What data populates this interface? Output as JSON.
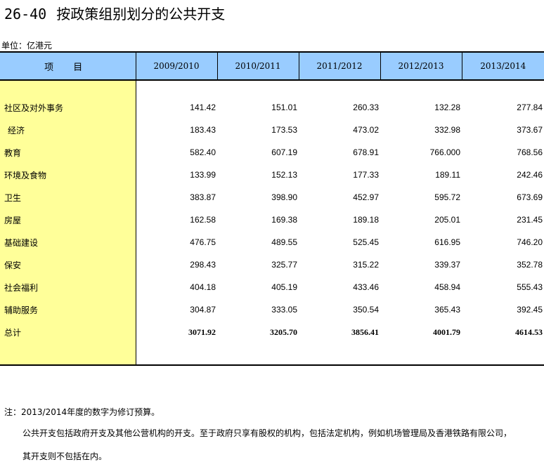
{
  "header": {
    "number": "26-40",
    "title": "按政策组别划分的公共开支",
    "unit": "单位：亿港元"
  },
  "table": {
    "columns": [
      "项 目",
      "2009/2010",
      "2010/2011",
      "2011/2012",
      "2012/2013",
      "2013/2014"
    ],
    "rows": [
      {
        "label": "社区及对外事务",
        "values": [
          "141.42",
          "151.01",
          "260.33",
          "132.28",
          "277.84"
        ]
      },
      {
        "label": "经济",
        "values": [
          "183.43",
          "173.53",
          "473.02",
          "332.98",
          "373.67"
        ]
      },
      {
        "label": "教育",
        "values": [
          "582.40",
          "607.19",
          "678.91",
          "766.000",
          "768.56"
        ]
      },
      {
        "label": "环境及食物",
        "values": [
          "133.99",
          "152.13",
          "177.33",
          "189.11",
          "242.46"
        ]
      },
      {
        "label": "卫生",
        "values": [
          "383.87",
          "398.90",
          "452.97",
          "595.72",
          "673.69"
        ]
      },
      {
        "label": "房屋",
        "values": [
          "162.58",
          "169.38",
          "189.18",
          "205.01",
          "231.45"
        ]
      },
      {
        "label": "基础建设",
        "values": [
          "476.75",
          "489.55",
          "525.45",
          "616.95",
          "746.20"
        ]
      },
      {
        "label": "保安",
        "values": [
          "298.43",
          "325.77",
          "315.22",
          "339.37",
          "352.78"
        ]
      },
      {
        "label": "社会福利",
        "values": [
          "404.18",
          "405.19",
          "433.46",
          "458.94",
          "555.43"
        ]
      },
      {
        "label": "辅助服务",
        "values": [
          "304.87",
          "333.05",
          "350.54",
          "365.43",
          "392.45"
        ]
      }
    ],
    "total": {
      "label": "总计",
      "values": [
        "3071.92",
        "3205.70",
        "3856.41",
        "4001.79",
        "4614.53"
      ]
    }
  },
  "notes": {
    "line1": "注：2013/2014年度的数字为修订预算。",
    "line2": "公共开支包括政府开支及其他公营机构的开支。至于政府只享有股权的机构，包括法定机构，例如机场管理局及香港铁路有限公司，",
    "line3": "其开支则不包括在内。"
  }
}
